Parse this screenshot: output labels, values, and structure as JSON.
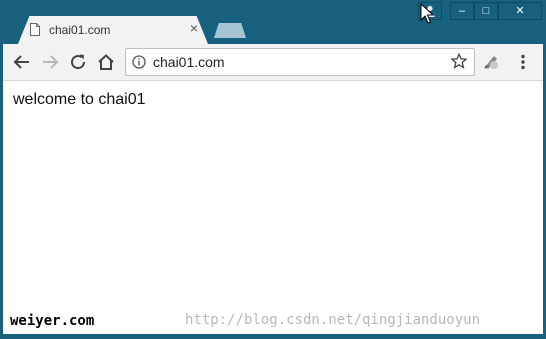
{
  "tab": {
    "title": "chai01.com",
    "close": "×"
  },
  "window_controls": {
    "minimize": "–",
    "maximize": "□",
    "close": "✕"
  },
  "toolbar": {
    "url": "chai01.com"
  },
  "content": {
    "text": "welcome to chai01"
  },
  "watermarks": {
    "left": "weiyer.com",
    "right": "http://blog.csdn.net/qingjianduoyun"
  },
  "colors": {
    "frame": "#17607e",
    "toolbar": "#f2f2f2",
    "content": "#ffffff"
  }
}
